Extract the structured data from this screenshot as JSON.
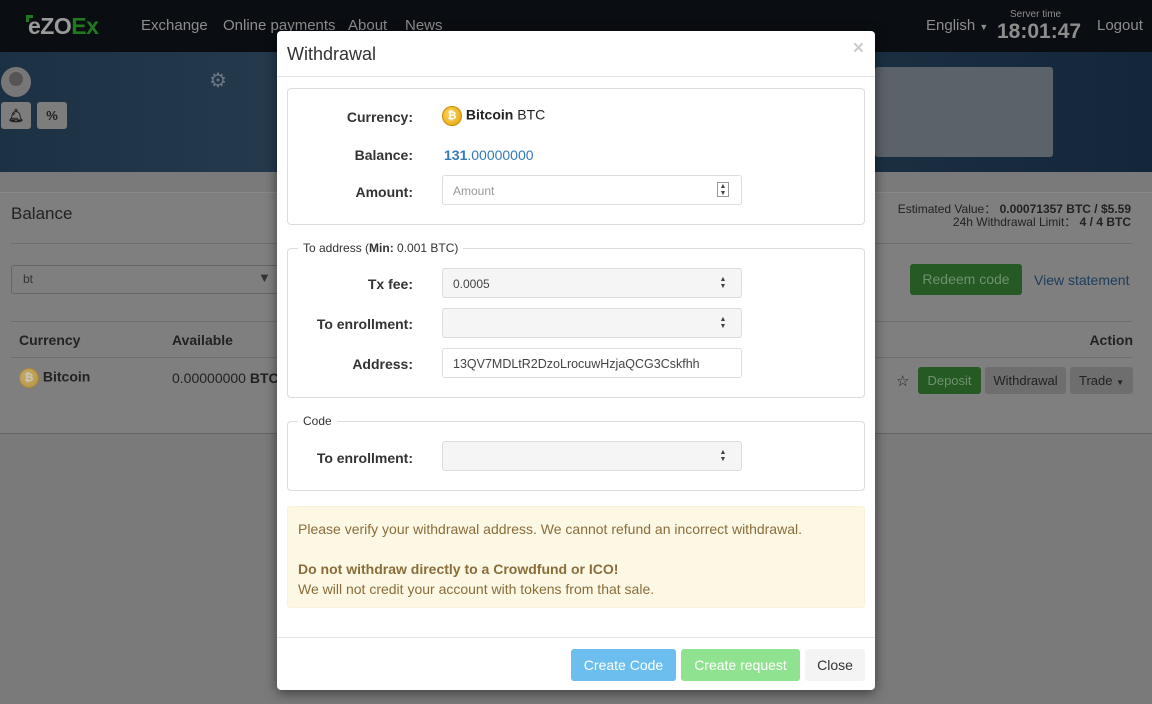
{
  "header": {
    "logo": {
      "part1": "eZO",
      "part2": "Ex"
    },
    "nav": [
      "Exchange",
      "Online payments",
      "About",
      "News"
    ],
    "language": "English",
    "server_time_label": "Server time",
    "server_time": "18:01:47",
    "logout": "Logout"
  },
  "sidebar": {
    "bell_icon": "bell-icon",
    "percent_label": "%"
  },
  "balance": {
    "title": "Balance",
    "estimated_label": "Estimated Value：",
    "estimated_value": "0.00071357 BTC / $5.59",
    "limit_label": "24h Withdrawal Limit：",
    "limit_value": "4 / 4 BTC",
    "filter_value": "bt",
    "redeem": "Redeem code",
    "statement": "View statement",
    "columns": {
      "currency": "Currency",
      "available": "Available",
      "action": "Action"
    },
    "rows": [
      {
        "currency": "Bitcoin",
        "available": "0.00000000",
        "unit": "BTC",
        "deposit": "Deposit",
        "withdrawal": "Withdrawal",
        "trade": "Trade"
      }
    ]
  },
  "modal": {
    "title": "Withdrawal",
    "close_x": "×",
    "currency_label": "Currency:",
    "currency_name": "Bitcoin",
    "currency_code": "BTC",
    "balance_label": "Balance:",
    "balance_int": "131",
    "balance_dec": ".00000000",
    "amount_label": "Amount:",
    "amount_placeholder": "Amount",
    "address_legend": {
      "pre": "To address (",
      "min_label": "Min:",
      "min_value": " 0.001 BTC)"
    },
    "txfee_label": "Tx fee:",
    "txfee_value": "0.0005",
    "enroll_label": "To enrollment:",
    "enroll_value": "",
    "address_label": "Address:",
    "address_value": "13QV7MDLtR2DzoLrocuwHzjaQCG3Cskfhh",
    "code_legend": "Code",
    "code_enroll_label": "To enrollment:",
    "warning": {
      "line1": "Please verify your withdrawal address. We cannot refund an incorrect withdrawal.",
      "bold": "Do not withdraw directly to a Crowdfund or ICO!",
      "line2": "We will not credit your account with tokens from that sale."
    },
    "buttons": {
      "create_code": "Create Code",
      "create_request": "Create request",
      "close": "Close"
    }
  },
  "colors": {
    "accent_blue": "#337ab7",
    "create_code": "#6bbeed",
    "create_request": "#8fe28f",
    "warning_bg": "#fcf8e3",
    "warning_text": "#8a6d3b"
  }
}
